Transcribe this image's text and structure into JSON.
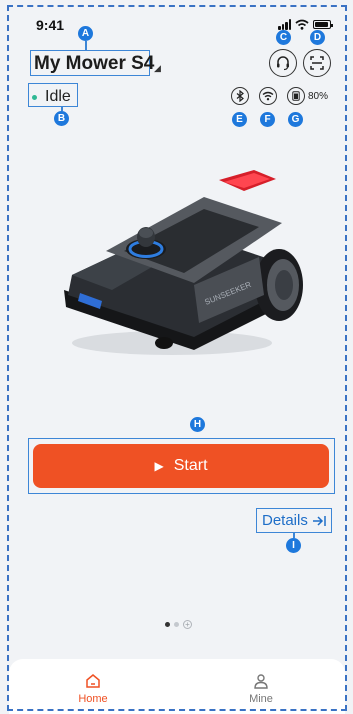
{
  "status_bar": {
    "time": "9:41"
  },
  "header": {
    "device_name": "My Mower S4",
    "status": "Idle",
    "status_color": "#2fb894",
    "battery_percent": "80%",
    "icons": [
      "headset-icon",
      "scan-icon",
      "bluetooth-icon",
      "wifi-icon",
      "battery-icon"
    ]
  },
  "main": {
    "start_label": "Start",
    "details_label": "Details",
    "mower_brand": "SUNSEEKER",
    "pager": {
      "count": 2,
      "active": 0
    }
  },
  "tabs": [
    {
      "label": "Home",
      "active": true
    },
    {
      "label": "Mine",
      "active": false
    }
  ],
  "annotations": [
    "A",
    "B",
    "C",
    "D",
    "E",
    "F",
    "G",
    "H",
    "I"
  ],
  "colors": {
    "accent": "#ef5124",
    "annotation": "#1e78dc",
    "link": "#1e6ec8"
  }
}
